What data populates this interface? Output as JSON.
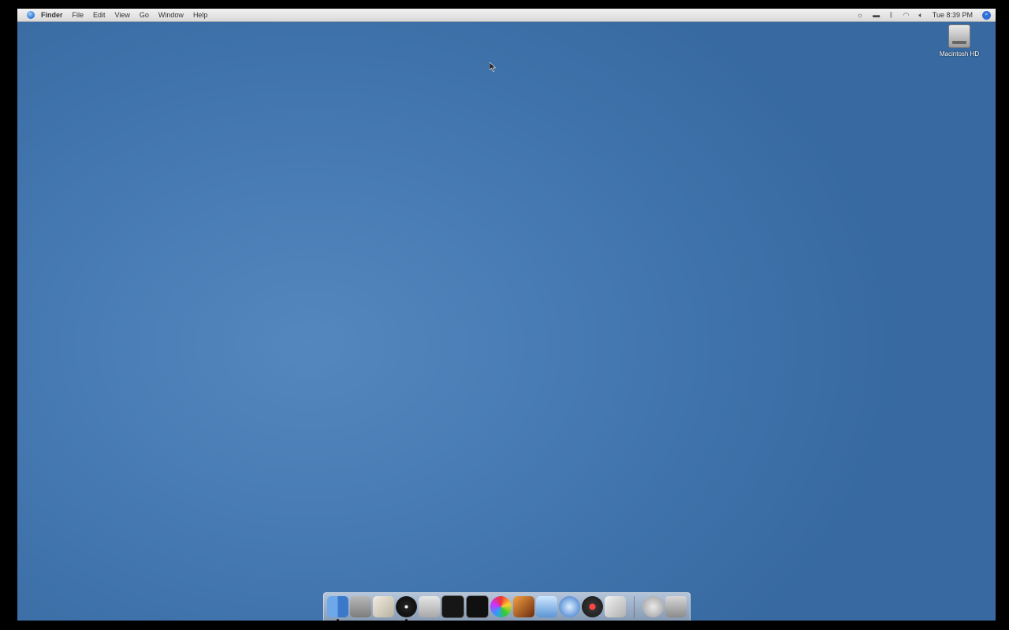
{
  "menubar": {
    "app_name": "Finder",
    "items": [
      "File",
      "Edit",
      "View",
      "Go",
      "Window",
      "Help"
    ],
    "clock": "Tue 8:39 PM"
  },
  "desktop": {
    "hd_label": "Macintosh HD"
  },
  "dock": {
    "apps": [
      "finder-icon",
      "calculator-icon",
      "solitaire-icon",
      "dvd-player-icon",
      "apple-icon",
      "activity-monitor-icon",
      "terminal-icon",
      "color-picker-icon",
      "photo-icon",
      "itunes-icon",
      "safari-icon",
      "paint-icon",
      "preview-icon"
    ],
    "right": [
      "download-icon",
      "trash-icon"
    ]
  }
}
